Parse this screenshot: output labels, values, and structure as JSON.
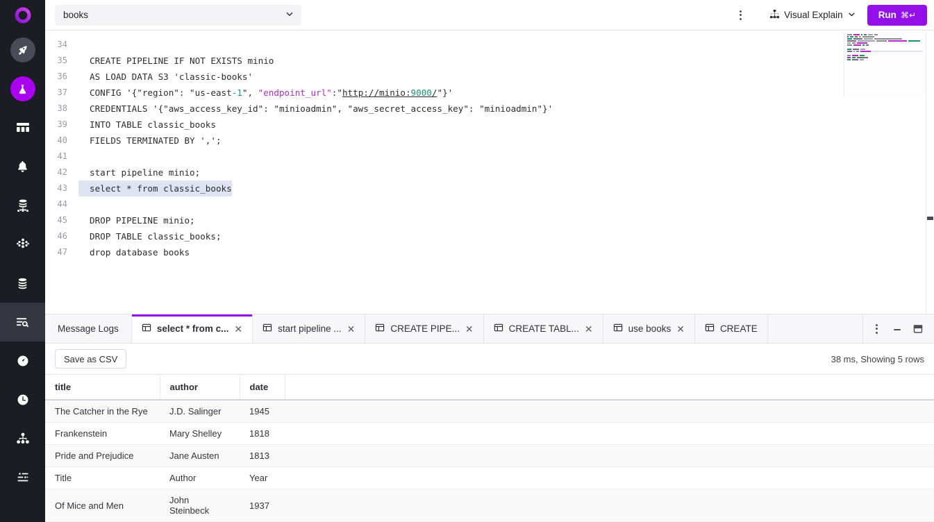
{
  "app": {
    "logo_icon": "singlestore-logo-icon",
    "accent": "#9310ea",
    "rail_active": "#aa00f0"
  },
  "topbar": {
    "database": "books",
    "chevron_icon": "chevron-down-icon",
    "kebab_icon": "more-vertical-icon",
    "visual_explain_label": "Visual Explain",
    "visual_explain_icon": "hierarchy-icon",
    "visual_explain_chevron": "chevron-down-icon",
    "run_label": "Run",
    "run_shortcut": "⌘↵"
  },
  "sidebar": {
    "items": [
      {
        "name": "deployments",
        "icon": "rocket-icon",
        "style": "gray-pill"
      },
      {
        "name": "notebooks",
        "icon": "flask-icon",
        "style": "purple-pill"
      },
      {
        "name": "dashboard",
        "icon": "dashboard-icon",
        "style": "plain"
      },
      {
        "name": "alerts",
        "icon": "bell-icon",
        "style": "plain"
      },
      {
        "name": "cluster",
        "icon": "database-cluster-icon",
        "style": "plain"
      },
      {
        "name": "nodes",
        "icon": "nodes-icon",
        "style": "plain"
      },
      {
        "name": "databases",
        "icon": "database-stack-icon",
        "style": "plain"
      },
      {
        "name": "sql-editor",
        "icon": "query-search-icon",
        "style": "active"
      },
      {
        "name": "performance",
        "icon": "gauge-icon",
        "style": "plain"
      },
      {
        "name": "history",
        "icon": "clock-icon",
        "style": "plain"
      },
      {
        "name": "topology",
        "icon": "sitemap-icon",
        "style": "plain"
      },
      {
        "name": "settings",
        "icon": "sliders-icon",
        "style": "plain"
      }
    ]
  },
  "editor": {
    "first_line_number": 34,
    "selected_line_number": 43,
    "lines": [
      {
        "n": 34,
        "text": ""
      },
      {
        "n": 35,
        "text": "CREATE PIPELINE IF NOT EXISTS minio"
      },
      {
        "n": 36,
        "text": "AS LOAD DATA S3 'classic-books'"
      },
      {
        "n": 37,
        "text": "CONFIG '{\"region\": \"us-east-1\", \"endpoint_url\":\"http://minio:9000/\"}'"
      },
      {
        "n": 38,
        "text": "CREDENTIALS '{\"aws_access_key_id\": \"minioadmin\", \"aws_secret_access_key\": \"minioadmin\"}'"
      },
      {
        "n": 39,
        "text": "INTO TABLE classic_books"
      },
      {
        "n": 40,
        "text": "FIELDS TERMINATED BY ',';"
      },
      {
        "n": 41,
        "text": ""
      },
      {
        "n": 42,
        "text": "start pipeline minio;"
      },
      {
        "n": 43,
        "text": "select * from classic_books"
      },
      {
        "n": 44,
        "text": ""
      },
      {
        "n": 45,
        "text": "DROP PIPELINE minio;"
      },
      {
        "n": 46,
        "text": "DROP TABLE classic_books;"
      },
      {
        "n": 47,
        "text": "drop database books"
      }
    ],
    "minimap_name": "code-minimap",
    "scrollbar_name": "editor-vertical-scrollbar"
  },
  "panel": {
    "message_logs_label": "Message Logs",
    "tab_icon": "table-grid-icon",
    "close_icon": "close-icon",
    "tabs": [
      {
        "label": "select * from c...",
        "active": true
      },
      {
        "label": "start pipeline ...",
        "active": false
      },
      {
        "label": "CREATE PIPE...",
        "active": false
      },
      {
        "label": "CREATE TABL...",
        "active": false
      },
      {
        "label": "use books",
        "active": false
      },
      {
        "label": "CREATE",
        "active": false
      }
    ],
    "actions": {
      "kebab_icon": "more-vertical-icon",
      "minimize_icon": "minimize-icon",
      "maximize_icon": "maximize-panel-icon"
    },
    "save_csv_label": "Save as CSV",
    "stats": "38 ms,  Showing 5 rows"
  },
  "results": {
    "columns": [
      "title",
      "author",
      "date"
    ],
    "rows": [
      [
        "The Catcher in the Rye",
        "J.D. Salinger",
        "1945"
      ],
      [
        "Frankenstein",
        "Mary Shelley",
        "1818"
      ],
      [
        "Pride and Prejudice",
        "Jane Austen",
        "1813"
      ],
      [
        "Title",
        "Author",
        "Year"
      ],
      [
        "Of Mice and Men",
        "John Steinbeck",
        "1937"
      ]
    ]
  }
}
